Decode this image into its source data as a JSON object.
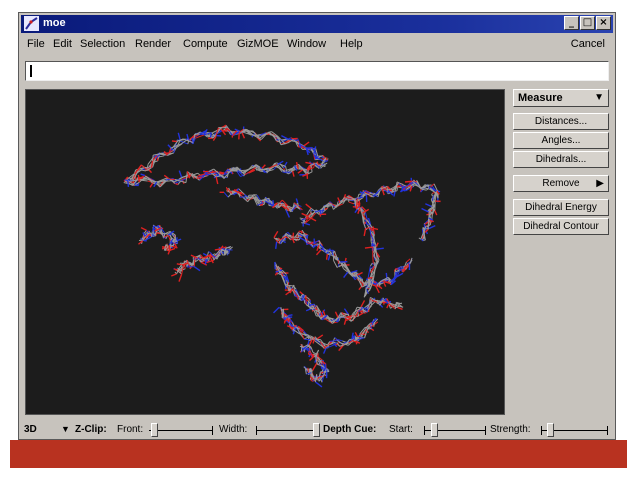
{
  "window": {
    "title": "moe",
    "buttons": [
      "_",
      "□",
      "×"
    ]
  },
  "menubar": {
    "items": [
      {
        "label": "File"
      },
      {
        "label": "Edit"
      },
      {
        "label": "Selection"
      },
      {
        "label": "Render"
      },
      {
        "label": "Compute"
      },
      {
        "label": "GizMOE"
      },
      {
        "label": "Window"
      },
      {
        "label": "Help"
      }
    ],
    "cancel_label": "Cancel"
  },
  "command_line": {
    "value": ""
  },
  "side_panel": {
    "measure_label": "Measure",
    "buttons": [
      {
        "label": "Distances..."
      },
      {
        "label": "Angles..."
      },
      {
        "label": "Dihedrals..."
      }
    ],
    "remove_label": "Remove",
    "energy_buttons": [
      {
        "label": "Dihedral Energy"
      },
      {
        "label": "Dihedral Contour"
      }
    ]
  },
  "statusbar": {
    "mode": "3D",
    "zclip_label": "Z-Clip:",
    "front_label": "Front:",
    "width_label": "Width:",
    "depth_cue_label": "Depth Cue:",
    "start_label": "Start:",
    "strength_label": "Strength:"
  },
  "colors": {
    "viewport_bg": "#1c1c1c",
    "carbon": "#9a9a9a",
    "nitrogen": "#2233dd",
    "oxygen": "#e02020",
    "slide_bar": "#b83220",
    "title_bar": "#0a1a7a"
  },
  "icons": {
    "app_icon": "moe-logo-icon",
    "dropdown": "triangle-down-icon",
    "submenu": "triangle-right-icon"
  }
}
